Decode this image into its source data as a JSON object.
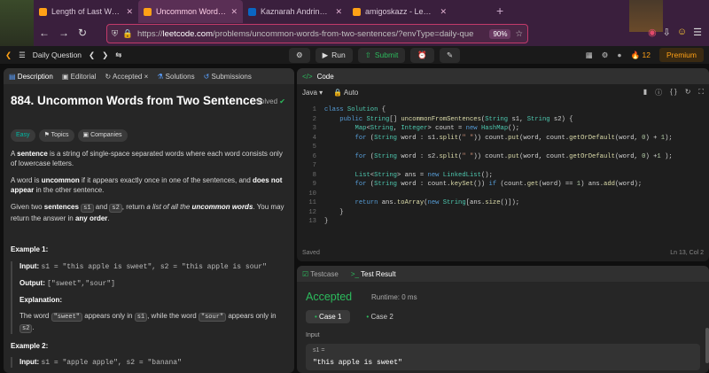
{
  "browser": {
    "tabs": [
      {
        "title": "Length of Last Word - LeetCode",
        "fav_color": "#ffa116",
        "active": false
      },
      {
        "title": "Uncommon Words from Two Sentences",
        "fav_color": "#ffa116",
        "active": true
      },
      {
        "title": "Kaznarah Andrinarivo | LinkedIn",
        "fav_color": "#0a66c2",
        "active": false
      },
      {
        "title": "amigoskazz - LeetCode Profile",
        "fav_color": "#ffa116",
        "active": false
      }
    ],
    "url_domain": "leetcode.com",
    "url_rest": "/problems/uncommon-words-from-two-sentences/?envType=daily-que",
    "url_prefix": "https://",
    "zoom": "90%"
  },
  "lc_nav": {
    "daily": "Daily Question",
    "run": "Run",
    "submit": "Submit",
    "streak": "12",
    "premium": "Premium"
  },
  "left_tabs": {
    "description": "Description",
    "editorial": "Editorial",
    "accepted": "Accepted",
    "solutions": "Solutions",
    "submissions": "Submissions"
  },
  "problem": {
    "title": "884. Uncommon Words from Two Sentences",
    "solved": "Solved",
    "difficulty": "Easy",
    "topics": "Topics",
    "companies": "Companies",
    "p1_bold": "sentence",
    "p1_pre": "A ",
    "p1_post": " is a string of single-space separated words where each word consists only of lowercase letters.",
    "p2_pre": "A word is ",
    "p2_bold1": "uncommon",
    "p2_mid": " if it appears exactly once in one of the sentences, and ",
    "p2_bold2": "does not appear",
    "p2_post": " in the other sentence.",
    "p3_pre": "Given two ",
    "p3_bold": "sentences",
    "p3_s1": "s1",
    "p3_and": " and ",
    "p3_s2": "s2",
    "p3_mid": ", return ",
    "p3_ital": "a list of all the ",
    "p3_ital_bold": "uncommon words",
    "p3_post": ". You may return the answer in ",
    "p3_bold2": "any order",
    "p3_end": ".",
    "ex1_title": "Example 1:",
    "ex1_input_label": "Input:",
    "ex1_input": "s1 = \"this apple is sweet\", s2 = \"this apple is sour\"",
    "ex1_output_label": "Output:",
    "ex1_output": "[\"sweet\",\"sour\"]",
    "ex1_expl_label": "Explanation:",
    "ex1_expl_pre": "The word ",
    "ex1_w1": "\"sweet\"",
    "ex1_expl_mid": " appears only in ",
    "ex1_s1": "s1",
    "ex1_expl_mid2": ", while the word ",
    "ex1_w2": "\"sour\"",
    "ex1_expl_mid3": " appears only in ",
    "ex1_s2": "s2",
    "ex1_expl_end": ".",
    "ex2_title": "Example 2:",
    "ex2_input_label": "Input:",
    "ex2_input": "s1 = \"apple apple\", s2 = \"banana\""
  },
  "code_panel": {
    "title": "Code",
    "language": "Java",
    "auto": "Auto",
    "saved": "Saved",
    "cursor": "Ln 13, Col 2"
  },
  "test_panel": {
    "testcase": "Testcase",
    "result": "Test Result",
    "status": "Accepted",
    "runtime": "Runtime: 0 ms",
    "case1": "Case 1",
    "case2": "Case 2",
    "input_label": "Input",
    "var": "s1 =",
    "value": "\"this apple is sweet\""
  }
}
